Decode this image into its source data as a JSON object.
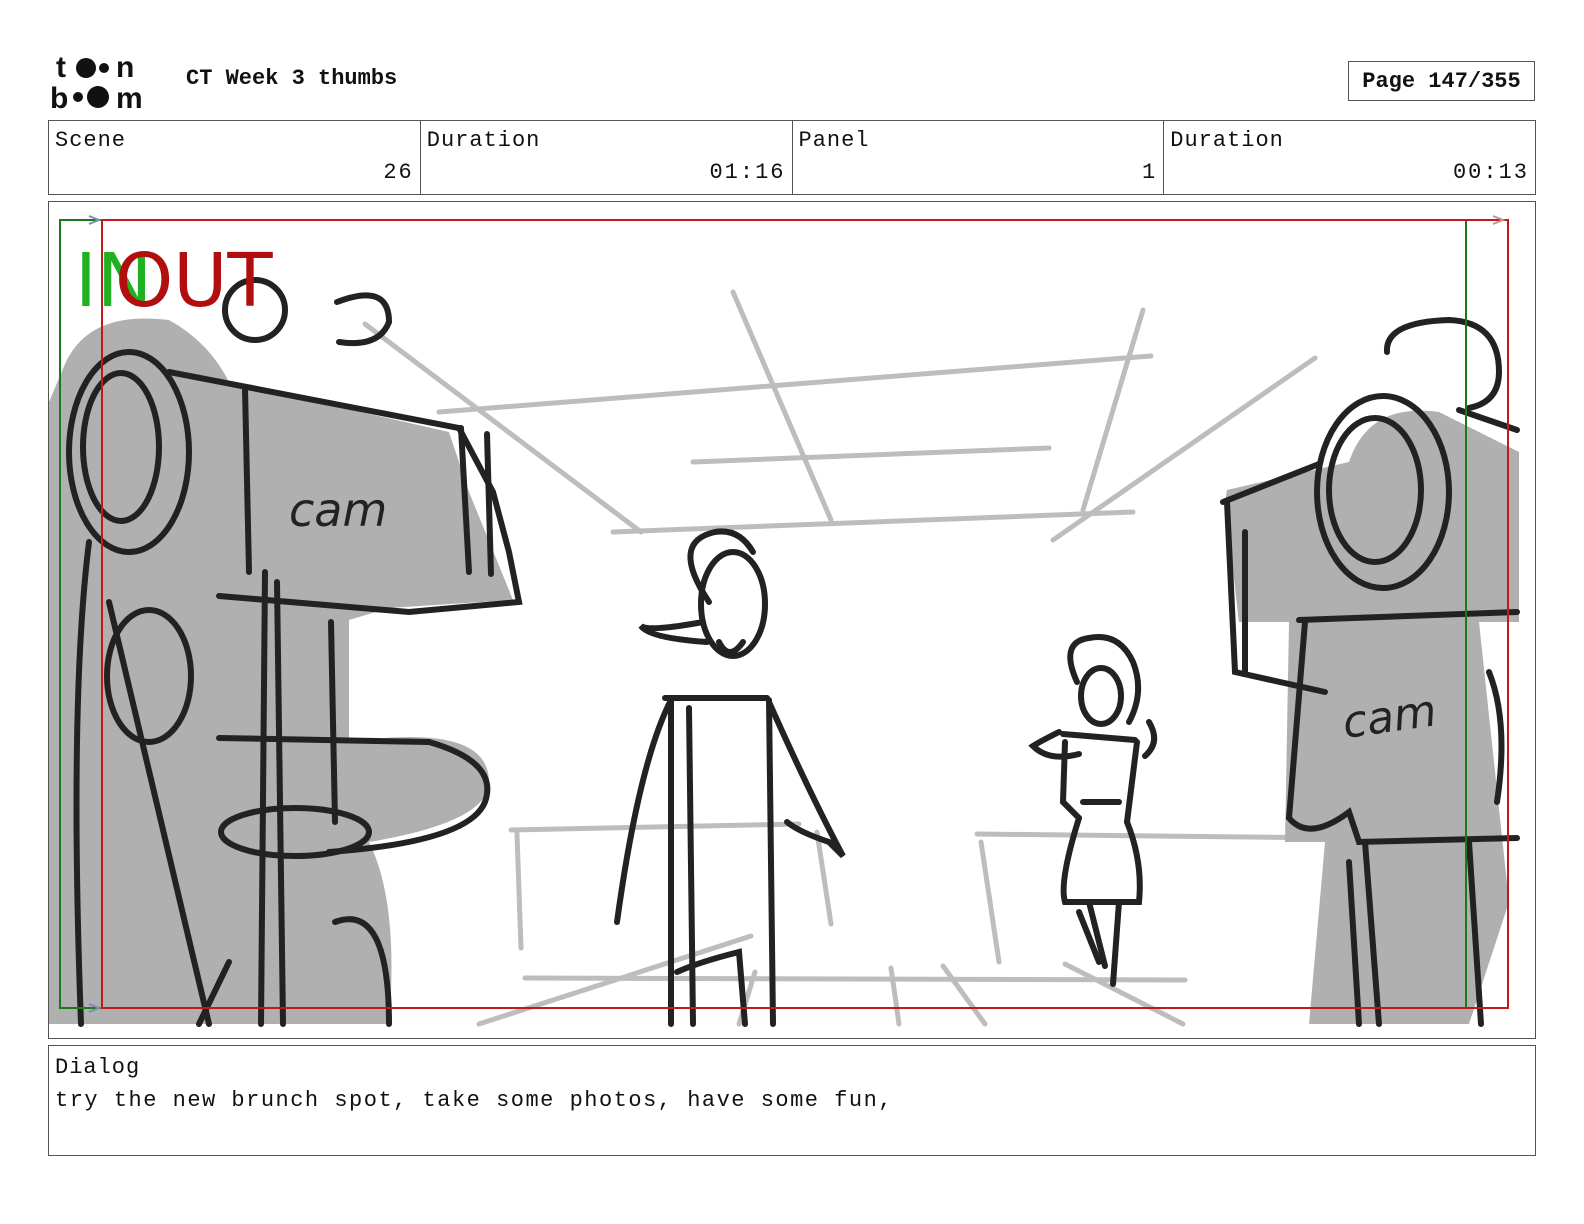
{
  "header": {
    "logo_text": "toon boom",
    "title": "CT Week 3 thumbs",
    "page_label": "Page 147/355"
  },
  "info": {
    "scene_label": "Scene",
    "scene_value": "26",
    "scene_duration_label": "Duration",
    "scene_duration_value": "01:16",
    "panel_label": "Panel",
    "panel_value": "1",
    "panel_duration_label": "Duration",
    "panel_duration_value": "00:13"
  },
  "panel": {
    "in_marker": "IN",
    "out_marker": "OUT",
    "cam_left_label": "cam",
    "cam_right_label": "cam",
    "colors": {
      "in_green": "#1fb11f",
      "out_red": "#b10f0f",
      "sketch_fill": "#b0b0b0",
      "sketch_line": "#222222",
      "guide_line": "#bdbdbd"
    }
  },
  "dialog": {
    "label": "Dialog",
    "text": "try the new brunch spot, take some photos, have some fun,"
  }
}
